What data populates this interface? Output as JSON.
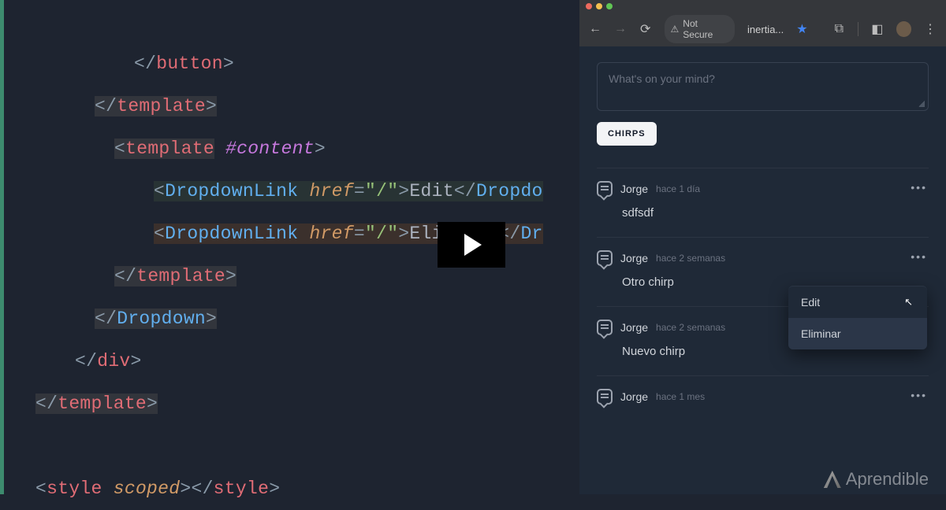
{
  "editor": {
    "l1": "</button>",
    "l2": "</template>",
    "l3_open": "<template",
    "l3_dir": "#content",
    "l4_comp": "DropdownLink",
    "l4_attr": "href",
    "l4_val": "\"/\"",
    "l4_text": "Edit",
    "l4_tail": "</Dropdo",
    "l5_text": "Eliminar",
    "l5_tail": "</Dr",
    "l6": "</template>",
    "l7": "</Dropdown>",
    "l8": "</div>",
    "l9": "</template>",
    "l10_open": "<style",
    "l10_attr": "scoped",
    "l10_close": "></style>"
  },
  "browser": {
    "security": "Not Secure",
    "tab": "inertia...",
    "composer_placeholder": "What's on your mind?",
    "button": "CHIRPS",
    "dropdown": {
      "edit": "Edit",
      "delete": "Eliminar"
    },
    "chirps": [
      {
        "author": "Jorge",
        "time": "hace 1 día",
        "body": "sdfsdf"
      },
      {
        "author": "Jorge",
        "time": "hace 2 semanas",
        "body": "Otro chirp"
      },
      {
        "author": "Jorge",
        "time": "hace 2 semanas",
        "body": "Nuevo chirp"
      },
      {
        "author": "Jorge",
        "time": "hace 1 mes",
        "body": ""
      }
    ]
  },
  "watermark": "Aprendible"
}
